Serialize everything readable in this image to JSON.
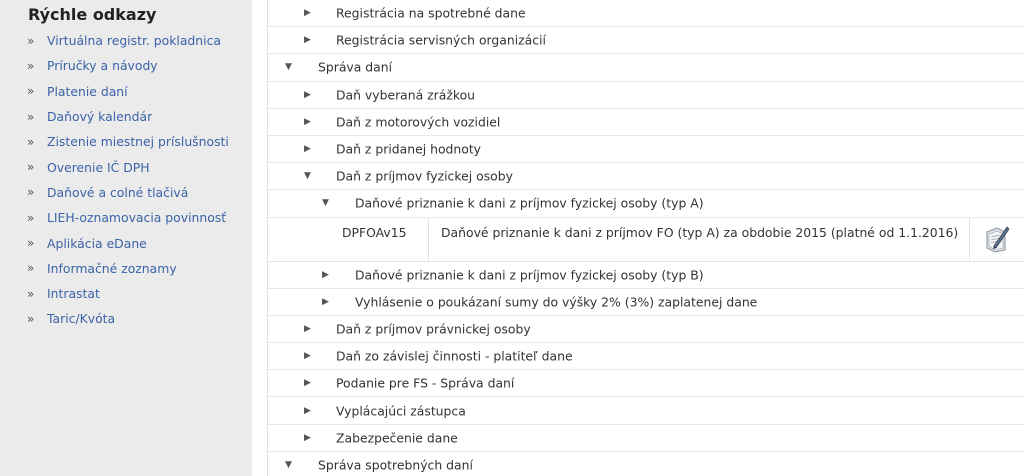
{
  "sidebar": {
    "title": "Rýchle odkazy",
    "marker": "»",
    "links": [
      "Virtuálna registr. pokladnica",
      "Príručky a návody",
      "Platenie daní",
      "Daňový kalendár",
      "Zistenie miestnej príslušnosti",
      "Overenie IČ DPH",
      "Daňové a colné tlačivá",
      "LIEH-oznamovacia povinnosť",
      "Aplikácia eDane",
      "Informačné zoznamy",
      "Intrastat",
      "Taric/Kvóta"
    ]
  },
  "tree": {
    "collapsed_icon": "▶",
    "expanded_icon": "▼",
    "rows_before": [
      {
        "label": "Registrácia na spotrebné dane",
        "level": 2,
        "expanded": false
      },
      {
        "label": "Registrácia servisných organizácií",
        "level": 2,
        "expanded": false
      },
      {
        "label": "Správa daní",
        "level": 1,
        "expanded": true
      },
      {
        "label": "Daň vyberaná zrážkou",
        "level": 2,
        "expanded": false
      },
      {
        "label": "Daň z motorových vozidiel",
        "level": 2,
        "expanded": false
      },
      {
        "label": "Daň z pridanej hodnoty",
        "level": 2,
        "expanded": false
      },
      {
        "label": "Daň z príjmov fyzickej osoby",
        "level": 2,
        "expanded": true
      },
      {
        "label": "Daňové priznanie k dani z príjmov fyzickej osoby (typ A)",
        "level": 3,
        "expanded": true
      }
    ],
    "document": {
      "code": "DPFOAv15",
      "description": "Daňové priznanie k dani z príjmov FO (typ A) za obdobie 2015 (platné od 1.1.2016)",
      "icon": "form-edit-icon"
    },
    "rows_after": [
      {
        "label": "Daňové priznanie k dani z príjmov fyzickej osoby (typ B)",
        "level": 3,
        "expanded": false
      },
      {
        "label": "Vyhlásenie o poukázaní sumy do výšky 2% (3%) zaplatenej dane",
        "level": 3,
        "expanded": false
      },
      {
        "label": "Daň z príjmov právnickej osoby",
        "level": 2,
        "expanded": false
      },
      {
        "label": "Daň zo závislej činnosti - platiteľ dane",
        "level": 2,
        "expanded": false
      },
      {
        "label": "Podanie pre FS - Správa daní",
        "level": 2,
        "expanded": false
      },
      {
        "label": "Vyplácajúci zástupca",
        "level": 2,
        "expanded": false
      },
      {
        "label": "Zabezpečenie dane",
        "level": 2,
        "expanded": false
      },
      {
        "label": "Správa spotrebných daní",
        "level": 1,
        "expanded": true
      }
    ]
  },
  "colors": {
    "link": "#3b63a8",
    "sidebar_bg": "#ebebeb"
  }
}
